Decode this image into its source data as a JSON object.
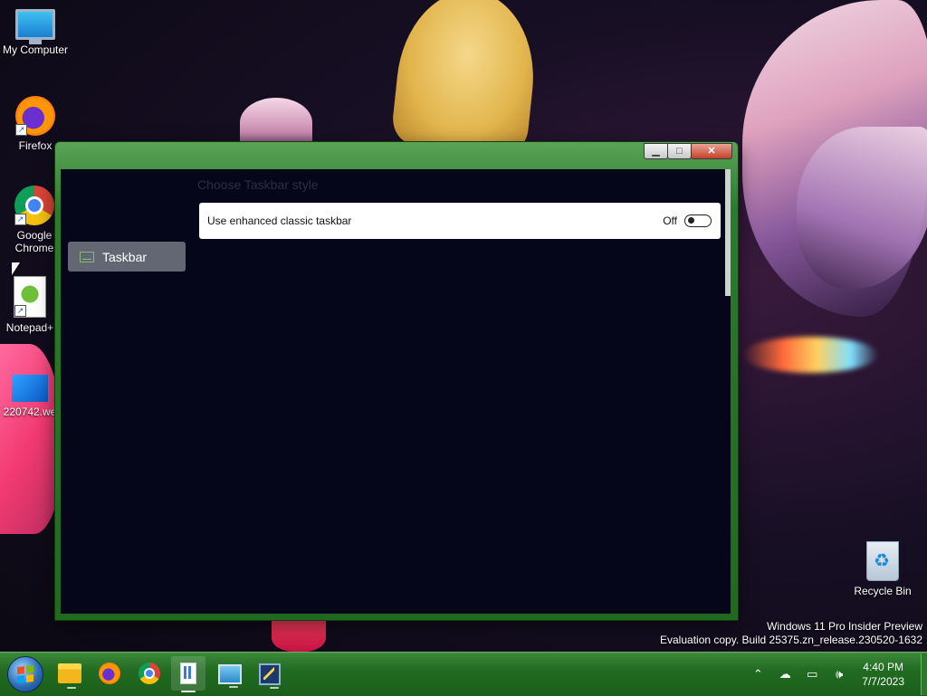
{
  "desktop": {
    "icons": [
      {
        "label": "My Computer",
        "icon": "computer-icon"
      },
      {
        "label": "Firefox",
        "icon": "firefox-icon"
      },
      {
        "label": "Google Chrome",
        "icon": "chrome-icon"
      },
      {
        "label": "Notepad+",
        "icon": "notepad-plus-plus-icon"
      },
      {
        "label": "220742.we",
        "icon": "windows-image-icon"
      },
      {
        "label": "Recycle Bin",
        "icon": "recycle-bin-icon"
      }
    ]
  },
  "window": {
    "controls": {
      "minimize": "▁",
      "maximize": "□",
      "close": "✕"
    },
    "sidebar": {
      "items": [
        {
          "label": "Taskbar",
          "icon": "taskbar-icon"
        }
      ]
    },
    "main": {
      "section_title": "Choose Taskbar style",
      "setting": {
        "label": "Use enhanced classic taskbar",
        "state_label": "Off",
        "enabled": false
      }
    }
  },
  "watermark": {
    "line1": "Windows 11 Pro Insider Preview",
    "line2": "Evaluation copy. Build 25375.zn_release.230520-1632"
  },
  "taskbar": {
    "apps": [
      "File Explorer",
      "Firefox",
      "Google Chrome",
      "Explorer Patcher",
      "Remote Desktop",
      "Tweaker"
    ],
    "tray": {
      "icons": [
        "chevron-up-icon",
        "onedrive-off-icon",
        "network-icon",
        "volume-icon"
      ],
      "time": "4:40 PM",
      "date": "7/7/2023"
    }
  },
  "colors": {
    "taskbar": "#226b22",
    "window_frame": "#2c7a2c",
    "client_bg": "#06061a"
  }
}
